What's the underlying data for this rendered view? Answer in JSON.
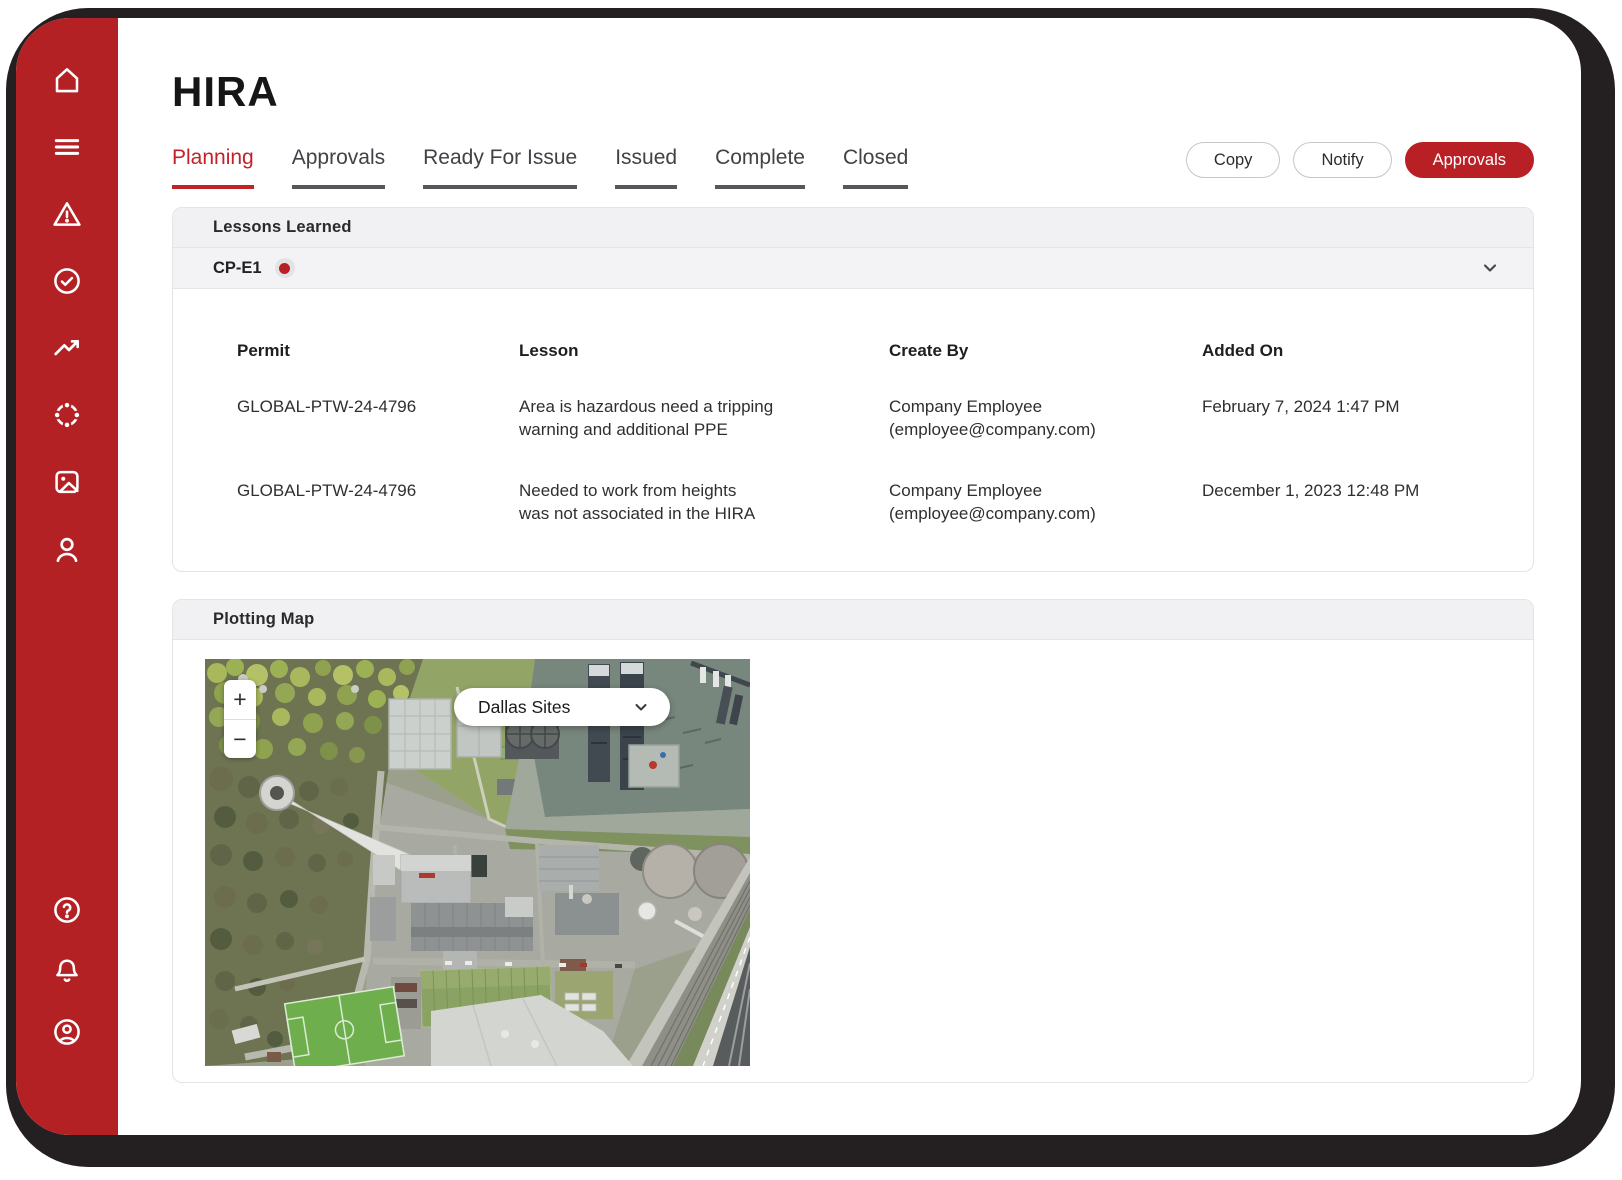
{
  "page_title": "HIRA",
  "colors": {
    "brand_red": "#B32125",
    "active_tab_red": "#C12127",
    "button_red": "#B92025",
    "frame_black": "#241F20",
    "panel_header_gray": "#F1F1F3"
  },
  "sidebar": {
    "top_icons": [
      "home-icon",
      "menu-icon",
      "alert-triangle-icon",
      "check-circle-icon",
      "trending-up-icon",
      "plot-points-icon",
      "image-icon",
      "user-icon"
    ],
    "bottom_icons": [
      "help-icon",
      "notifications-bell-icon",
      "account-icon"
    ]
  },
  "tabs": {
    "items": [
      {
        "label": "Planning",
        "active": true
      },
      {
        "label": "Approvals",
        "active": false
      },
      {
        "label": "Ready For Issue",
        "active": false
      },
      {
        "label": "Issued",
        "active": false
      },
      {
        "label": "Complete",
        "active": false
      },
      {
        "label": "Closed",
        "active": false
      }
    ]
  },
  "toolbar": {
    "copy_label": "Copy",
    "notify_label": "Notify",
    "approvals_label": "Approvals"
  },
  "lessons_learned": {
    "panel_title": "Lessons Learned",
    "group_label": "CP-E1",
    "columns": [
      "Permit",
      "Lesson",
      "Create By",
      "Added On"
    ],
    "rows": [
      {
        "permit": "GLOBAL-PTW-24-4796",
        "lesson": "Area is hazardous need a tripping\nwarning and additional PPE",
        "create_by": "Company Employee\n(employee@company.com)",
        "added_on": "February 7, 2024 1:47 PM"
      },
      {
        "permit": "GLOBAL-PTW-24-4796",
        "lesson": "Needed to work from heights\nwas not associated in the HIRA",
        "create_by": "Company Employee\n(employee@company.com)",
        "added_on": "December 1, 2023 12:48 PM"
      }
    ]
  },
  "plotting_map": {
    "panel_title": "Plotting Map",
    "site_selector_value": "Dallas Sites",
    "zoom_in_label": "+",
    "zoom_out_label": "−"
  }
}
